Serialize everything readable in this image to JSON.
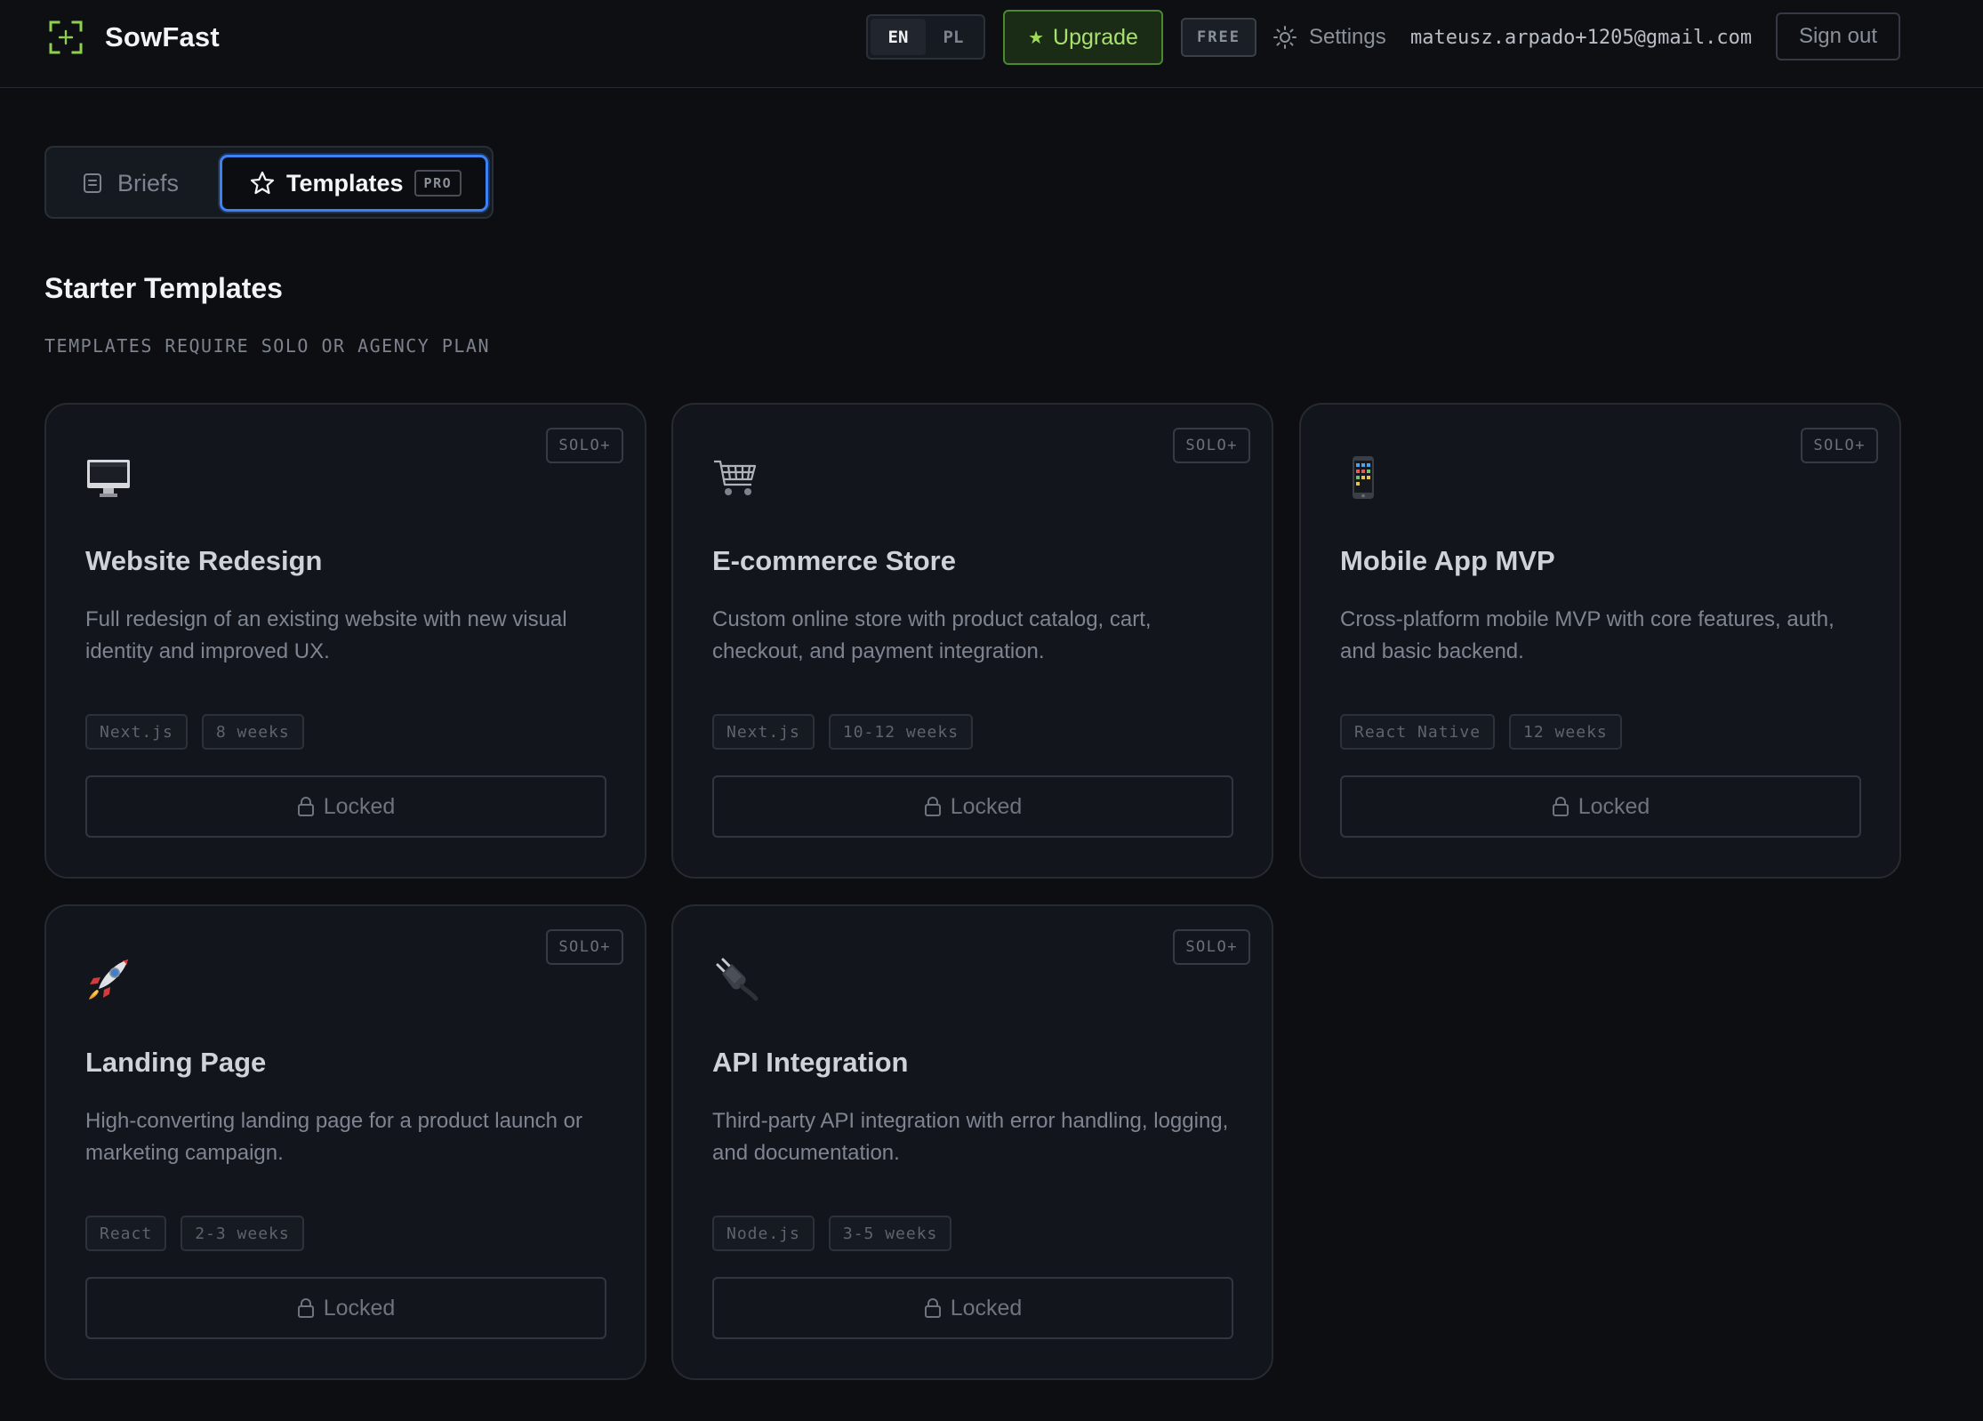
{
  "header": {
    "brand_name": "SowFast",
    "languages": [
      "EN",
      "PL"
    ],
    "active_language": "EN",
    "upgrade_label": "Upgrade",
    "plan_badge": "FREE",
    "settings_label": "Settings",
    "user_email": "mateusz.arpado+1205@gmail.com",
    "signout_label": "Sign out"
  },
  "tabs": {
    "briefs_label": "Briefs",
    "templates_label": "Templates",
    "templates_badge": "PRO",
    "active": "templates"
  },
  "section": {
    "title": "Starter Templates",
    "subtitle": "TEMPLATES REQUIRE SOLO OR AGENCY PLAN"
  },
  "templates": [
    {
      "icon": "desktop-computer-icon",
      "title": "Website Redesign",
      "description": "Full redesign of an existing website with new visual identity and improved UX.",
      "tags": [
        "Next.js",
        "8 weeks"
      ],
      "tier": "SOLO+",
      "action_label": "Locked"
    },
    {
      "icon": "shopping-cart-icon",
      "title": "E-commerce Store",
      "description": "Custom online store with product catalog, cart, checkout, and payment integration.",
      "tags": [
        "Next.js",
        "10-12 weeks"
      ],
      "tier": "SOLO+",
      "action_label": "Locked"
    },
    {
      "icon": "mobile-phone-icon",
      "title": "Mobile App MVP",
      "description": "Cross-platform mobile MVP with core features, auth, and basic backend.",
      "tags": [
        "React Native",
        "12 weeks"
      ],
      "tier": "SOLO+",
      "action_label": "Locked"
    },
    {
      "icon": "rocket-icon",
      "title": "Landing Page",
      "description": "High-converting landing page for a product launch or marketing campaign.",
      "tags": [
        "React",
        "2-3 weeks"
      ],
      "tier": "SOLO+",
      "action_label": "Locked"
    },
    {
      "icon": "electric-plug-icon",
      "title": "API Integration",
      "description": "Third-party API integration with error handling, logging, and documentation.",
      "tags": [
        "Node.js",
        "3-5 weeks"
      ],
      "tier": "SOLO+",
      "action_label": "Locked"
    }
  ],
  "colors": {
    "background": "#0c0e12",
    "card": "#12161c",
    "accent_green": "#9edb5b",
    "accent_blue": "#3c82f6"
  }
}
